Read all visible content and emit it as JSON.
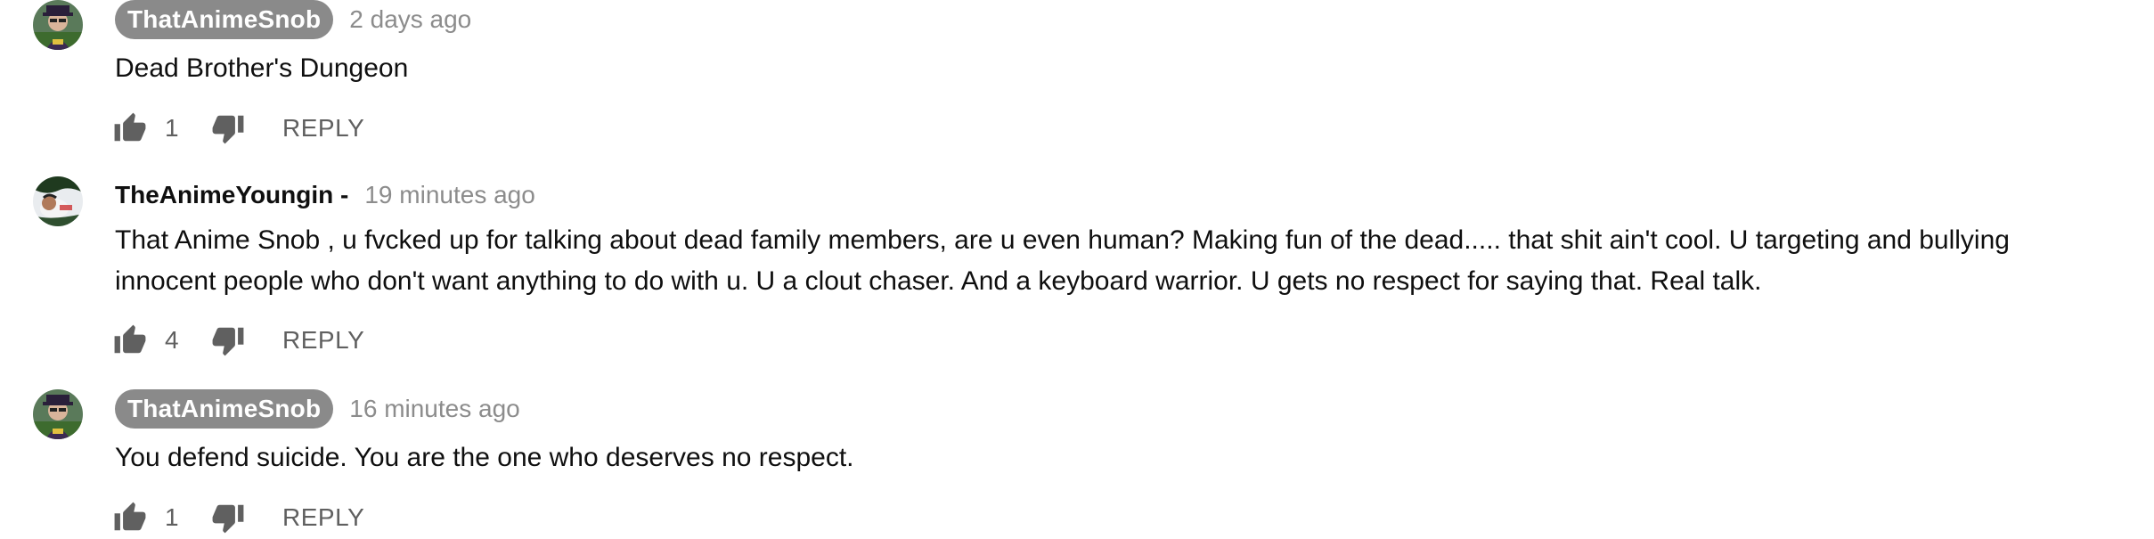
{
  "comments": [
    {
      "author": "ThatAnimeSnob",
      "author_style": "badge",
      "timestamp": "2 days ago",
      "text": "Dead Brother's Dungeon",
      "likes": "1",
      "reply_label": "REPLY",
      "avatar_icon": "snob-avatar"
    },
    {
      "author": "TheAnimeYoungin -",
      "author_style": "plain",
      "timestamp": "19 minutes ago",
      "text": "That Anime Snob , u fvcked up for talking about dead family members, are u even human? Making fun of the dead..... that shit ain't cool. U targeting and bullying innocent people who don't want anything to do with u. U a clout chaser. And a keyboard warrior. U gets no respect for saying that. Real talk.",
      "likes": "4",
      "reply_label": "REPLY",
      "avatar_icon": "youngin-avatar"
    },
    {
      "author": "ThatAnimeSnob",
      "author_style": "badge",
      "timestamp": "16 minutes ago",
      "text": "You defend suicide. You are the one who deserves no respect.",
      "likes": "1",
      "reply_label": "REPLY",
      "avatar_icon": "snob-avatar"
    }
  ],
  "icons": {
    "like": "thumbs-up-icon",
    "dislike": "thumbs-down-icon"
  },
  "colors": {
    "badge_bg": "#8a8a8a",
    "timestamp": "#8c8c8c",
    "action": "#606060",
    "text": "#0f0f0f"
  }
}
